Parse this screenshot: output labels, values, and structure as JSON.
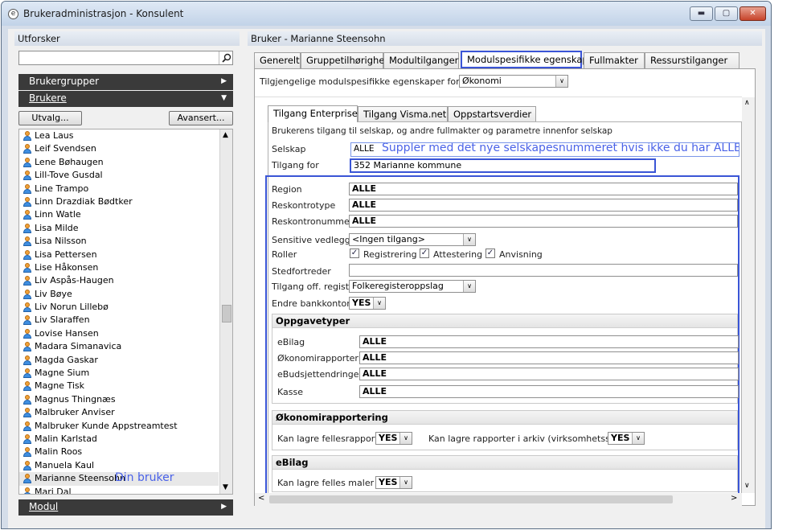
{
  "window": {
    "title": "Brukeradministrasjon - Konsulent",
    "minimize": "▬",
    "maximize": "▢",
    "close": "✕",
    "icon": "e-icon"
  },
  "explorer": {
    "header": "Utforsker",
    "search_value": "",
    "groups_label": "Brukergrupper",
    "users_label": "Brukere",
    "module_label": "Modul",
    "select_button": "Utvalg...",
    "advanced_button": "Avansert...",
    "users": [
      "Lea Laus",
      "Leif Svendsen",
      "Lene Bøhaugen",
      "Lill-Tove Gusdal",
      "Line Trampo",
      "Linn Drazdiak Bødtker",
      "Linn Watle",
      "Lisa Milde",
      "Lisa Nilsson",
      "Lisa Pettersen",
      "Lise Håkonsen",
      "Liv Aspås-Haugen",
      "Liv Bøye",
      "Liv Norun Lillebø",
      "Liv Slaraffen",
      "Lovise Hansen",
      "Madara Simanavica",
      "Magda Gaskar",
      "Magne Sium",
      "Magne Tisk",
      "Magnus Thingnæs",
      "Malbruker Anviser",
      "Malbruker Kunde Appstreamtest",
      "Malin Karlstad",
      "Malin Roos",
      "Manuela Kaul",
      "Marianne Steensohn",
      "Mari Dal"
    ],
    "selected_user_annotation": "Din bruker"
  },
  "user_panel": {
    "header": "Bruker - Marianne Steensohn",
    "tabs": [
      "Generelt",
      "Gruppetilhørighet",
      "Modultilganger",
      "Modulspesifikke egenskaper",
      "Fullmakter",
      "Ressurstilganger"
    ],
    "module_prop_label": "Tilgjengelige modulspesifikke egenskaper for modul",
    "module_value": "Økonomi",
    "subtabs": [
      "Tilgang Enterprise",
      "Tilgang Visma.net",
      "Oppstartsverdier"
    ],
    "description": "Brukerens tilgang til selskap, og andre fullmakter og parametre innenfor selskap",
    "company_label": "Selskap",
    "company_value": "ALLE",
    "company_annotation": "Suppler med det nye selskapesnummeret hvis ikke du har ALLE her",
    "access_for_label": "Tilgang for",
    "access_for_value": "352 Marianne kommune",
    "fields": {
      "region_label": "Region",
      "region_value": "ALLE",
      "reskontrotype_label": "Reskontrotype",
      "reskontrotype_value": "ALLE",
      "reskontronummer_label": "Reskontronummer",
      "reskontronummer_value": "ALLE",
      "sensitive_label": "Sensitive vedlegg",
      "sensitive_value": "<Ingen tilgang>",
      "roller_label": "Roller",
      "role_registrering": "Registrering",
      "role_attestering": "Attestering",
      "role_anvisning": "Anvisning",
      "stedfortreder_label": "Stedfortreder",
      "stedfortreder_value": "",
      "offreg_label": "Tilgang off. register",
      "offreg_value": "Folkeregisteroppslag",
      "bank_label": "Endre bankkontonr.",
      "bank_value": "YES"
    },
    "oppgavetyper": {
      "header": "Oppgavetyper",
      "ebilag_label": "eBilag",
      "ebilag_value": "ALLE",
      "okrapp_label": "Økonomirapportering",
      "okrapp_value": "ALLE",
      "ebud_label": "eBudsjettendringer",
      "ebud_value": "ALLE",
      "kasse_label": "Kasse",
      "kasse_value": "ALLE"
    },
    "okonomirapportering": {
      "header": "Økonomirapportering",
      "fellesrapporter_label": "Kan lagre fellesrapporter",
      "fellesrapporter_value": "YES",
      "arkiv_label": "Kan lagre rapporter i arkiv (virksomhetsstyring)",
      "arkiv_value": "YES"
    },
    "ebilag": {
      "header": "eBilag",
      "felles_maler_label": "Kan lagre felles maler",
      "felles_maler_value": "YES"
    }
  }
}
